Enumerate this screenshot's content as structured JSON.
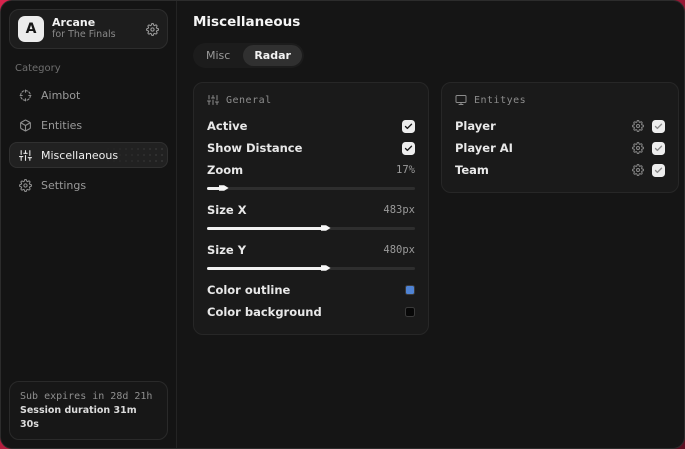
{
  "app": {
    "logo_letter": "A",
    "name": "Arcane",
    "subtitle": "for The Finals"
  },
  "sidebar": {
    "category_label": "Category",
    "items": [
      {
        "label": "Aimbot",
        "icon": "crosshair-icon",
        "active": false
      },
      {
        "label": "Entities",
        "icon": "box-icon",
        "active": false
      },
      {
        "label": "Miscellaneous",
        "icon": "sliders-icon",
        "active": true
      },
      {
        "label": "Settings",
        "icon": "gear-icon",
        "active": false
      }
    ],
    "footer": {
      "sub_expires": "Sub expires in 28d 21h",
      "session_duration": "Session duration 31m 30s"
    }
  },
  "main": {
    "title": "Miscellaneous",
    "tabs": [
      {
        "label": "Misc",
        "active": false
      },
      {
        "label": "Radar",
        "active": true
      }
    ]
  },
  "general_panel": {
    "title": "General",
    "icon": "sliders-icon",
    "active": {
      "label": "Active",
      "checked": true
    },
    "show_distance": {
      "label": "Show Distance",
      "checked": true
    },
    "zoom": {
      "label": "Zoom",
      "value": "17%",
      "fill": "8%"
    },
    "size_x": {
      "label": "Size X",
      "value": "483px",
      "fill": "57%"
    },
    "size_y": {
      "label": "Size Y",
      "value": "480px",
      "fill": "57%"
    },
    "color_outline": {
      "label": "Color outline",
      "color": "#4f83d4"
    },
    "color_background": {
      "label": "Color background",
      "color": "#070707"
    }
  },
  "entities_panel": {
    "title": "Entityes",
    "icon": "monitor-icon",
    "rows": [
      {
        "label": "Player",
        "checked": true
      },
      {
        "label": "Player AI",
        "checked": true
      },
      {
        "label": "Team",
        "checked": true
      }
    ]
  },
  "colors": {
    "accent_blue": "#4f83d4",
    "backdrop_red": "#b51d3e",
    "window_bg": "#151515",
    "panel_bg": "#1a1a1a"
  }
}
